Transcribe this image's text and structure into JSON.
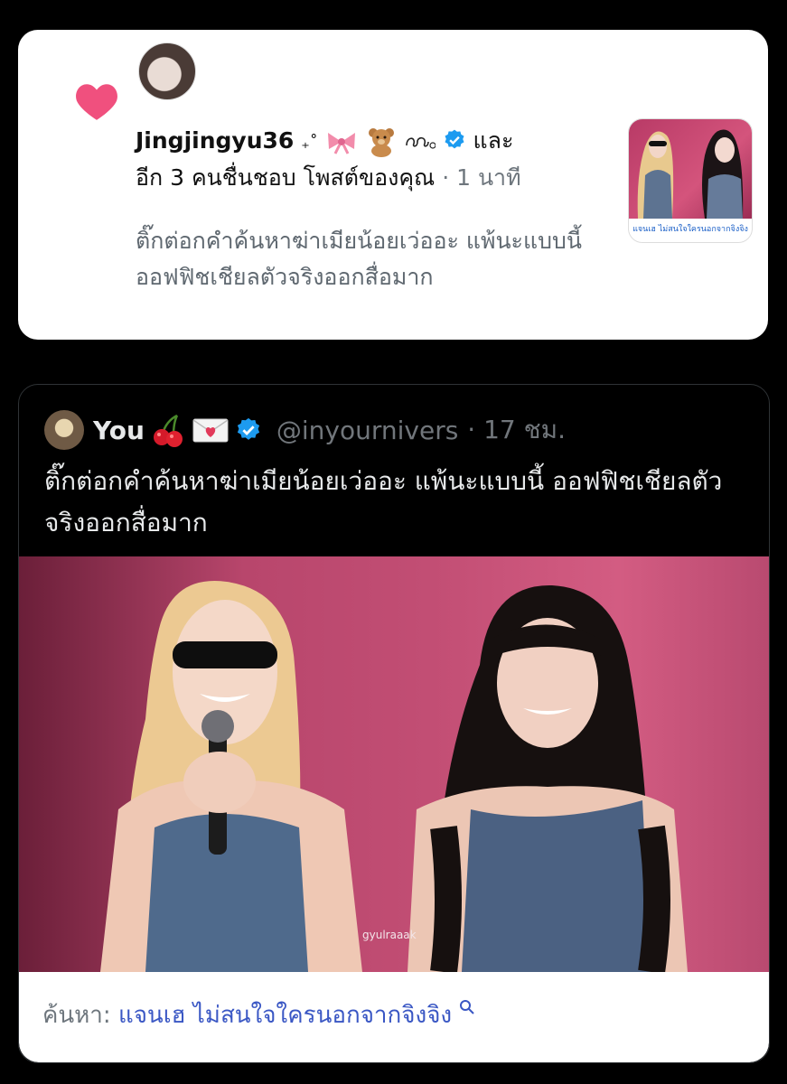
{
  "notification": {
    "user": "Jingjingyu36",
    "decor": "₊˚",
    "and": "และ",
    "others": "อีก 3 คนชื่นชอบ โพสต์ของคุณ",
    "time": "· 1 นาที",
    "body": "ติ๊กต่อกคำค้นหาฆ่าเมียน้อยเว่ออะ แพ้นะแบบนี้ ออฟฟิชเชียลตัวจริงออกสื่อมาก",
    "thumb_caption": "แจนเฮ ไม่สนใจใครนอกจากจิงจิง"
  },
  "post": {
    "name": "You",
    "handle": "@inyournivers",
    "time": "· 17 ชม.",
    "text": "ติ๊กต่อกคำค้นหาฆ่าเมียน้อยเว่ออะ แพ้นะแบบนี้ ออฟฟิชเชียลตัวจริงออกสื่อมาก",
    "watermark": "gyulraaak"
  },
  "search": {
    "prefix": "ค้นหา:",
    "query": "แจนเฮ ไม่สนใจใครนอกจากจิงจิง"
  },
  "icons": {
    "heart": "heart-icon",
    "verified": "verified-badge-icon",
    "search": "search-icon"
  },
  "colors": {
    "heart": "#f0507e",
    "verified": "#1d9bf0",
    "link": "#3a57c4"
  }
}
